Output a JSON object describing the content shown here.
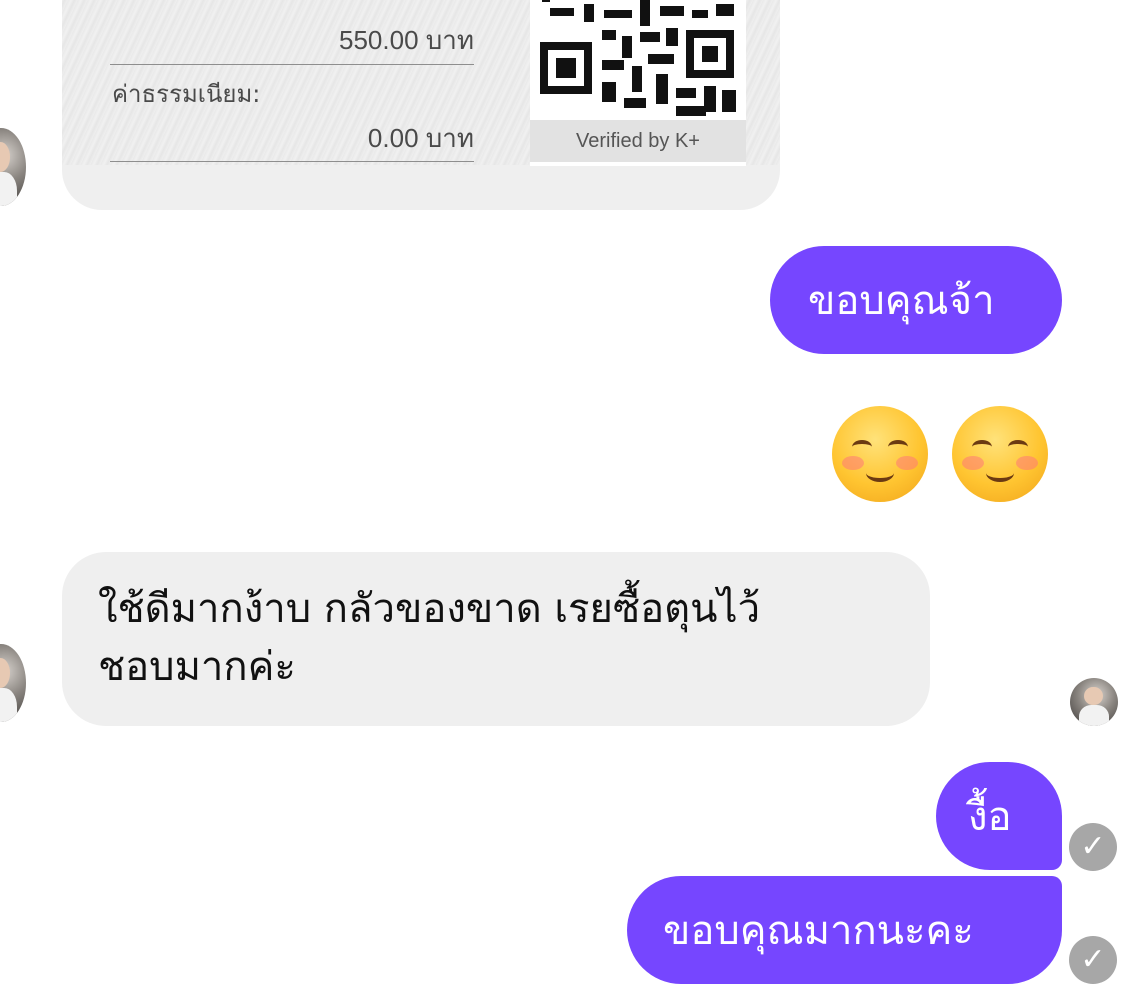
{
  "receipt": {
    "amount_value": "550.00 บาท",
    "fee_label": "ค่าธรรมเนียม:",
    "fee_value": "0.00 บาท",
    "qr_caption": "Verified by K+"
  },
  "messages": [
    {
      "text": "ขอบคุณจ้า"
    },
    {
      "text": "☺️ ☺️"
    },
    {
      "line1": "ใช้ดีมากง้าบ กลัวของขาด เรยซื้อตุนไว้",
      "line2": "ชอบมากค่ะ"
    },
    {
      "text": "งื้อ"
    },
    {
      "text": "ขอบคุณมากนะคะ"
    }
  ],
  "colors": {
    "outgoing_bubble": "#7646ff",
    "incoming_bubble": "#efefef",
    "status_check": "#a7a7a7"
  },
  "icons": {
    "seen_status": "checkmark-icon",
    "emoji": "smiling-face-icon"
  }
}
